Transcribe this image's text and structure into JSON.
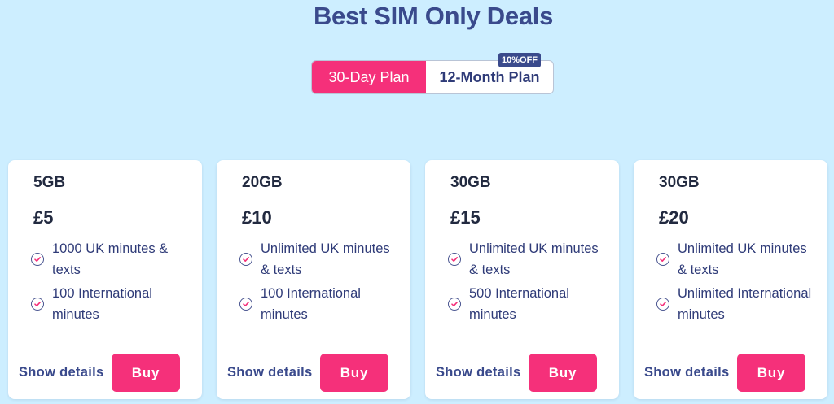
{
  "page": {
    "title": "Best SIM Only Deals"
  },
  "plan_toggle": {
    "options": [
      "30-Day Plan",
      "12-Month Plan"
    ],
    "selected": "30-Day Plan",
    "badge": "10%OFF"
  },
  "colors": {
    "background": "#cdeeff",
    "accent": "#f5307a",
    "brand": "#3a4a8c",
    "card": "#ffffff"
  },
  "plans": [
    {
      "data": "5GB",
      "price": "£5",
      "features": [
        "1000 UK minutes & texts",
        "100 International minutes"
      ],
      "details_label": "Show details",
      "buy_label": "Buy"
    },
    {
      "data": "20GB",
      "price": "£10",
      "features": [
        "Unlimited UK minutes & texts",
        "100 International minutes"
      ],
      "details_label": "Show details",
      "buy_label": "Buy"
    },
    {
      "data": "30GB",
      "price": "£15",
      "features": [
        "Unlimited UK minutes & texts",
        "500 International minutes"
      ],
      "details_label": "Show details",
      "buy_label": "Buy"
    },
    {
      "data": "30GB",
      "price": "£20",
      "features": [
        "Unlimited UK minutes & texts",
        "Unlimited International minutes"
      ],
      "details_label": "Show details",
      "buy_label": "Buy"
    }
  ],
  "icons": {
    "feature": "check-circle-icon"
  }
}
